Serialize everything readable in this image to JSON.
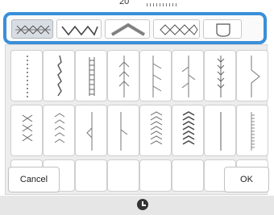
{
  "top": {
    "fragment_text": "20°"
  },
  "categories": [
    {
      "name": "cross-stitch"
    },
    {
      "name": "wave-stitch"
    },
    {
      "name": "arch-stitch"
    },
    {
      "name": "diamond-stitch"
    },
    {
      "name": "shield-stitch"
    }
  ],
  "stitch_rows": [
    [
      "dotted-vertical",
      "slanted-zigzag",
      "ladder",
      "feather",
      "hook",
      "branch",
      "triple-feather",
      "zigzag-spike"
    ],
    [
      "cross-chain",
      "chevron-vertical",
      "arrow-tip",
      "side-spike",
      "double-chevron",
      "double-chevron-bold",
      "straight-bar",
      "fine-ladder"
    ],
    [
      "partial-1",
      "partial-2",
      "partial-3",
      "partial-4",
      "partial-5",
      "partial-6",
      "partial-7",
      "partial-8"
    ]
  ],
  "buttons": {
    "cancel": "Cancel",
    "ok": "OK"
  },
  "status": {
    "icon": "clock-icon"
  },
  "colors": {
    "accent": "#3a8fd9"
  }
}
